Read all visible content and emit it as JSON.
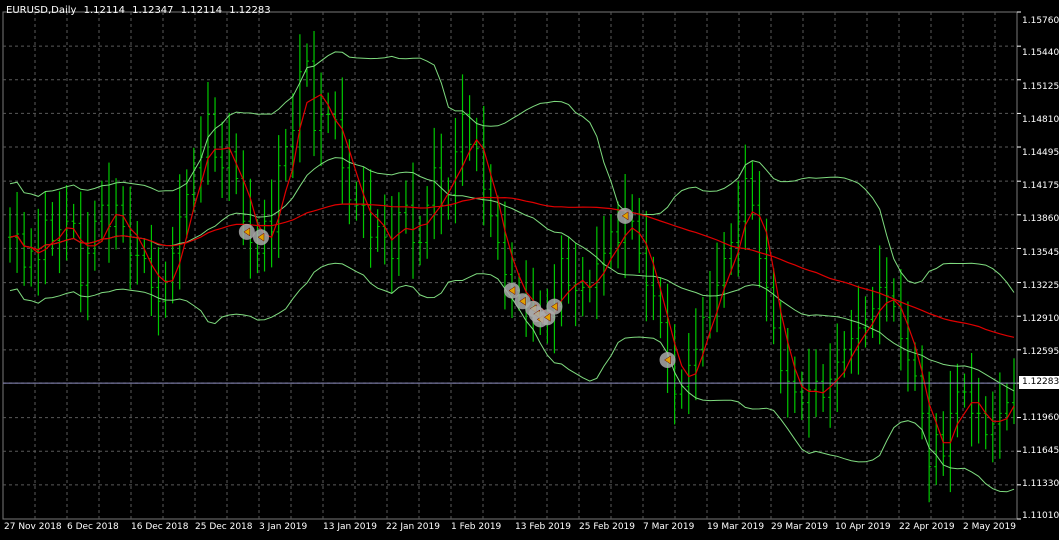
{
  "header": {
    "symbol": "EURUSD,Daily",
    "open": "1.12114",
    "high": "1.12347",
    "low": "1.12114",
    "close": "1.12283"
  },
  "price_axis": {
    "ticks": [
      "1.15760",
      "1.15440",
      "1.15125",
      "1.14810",
      "1.14495",
      "1.14175",
      "1.13860",
      "1.13545",
      "1.13225",
      "1.12910",
      "1.12595",
      "1.12283",
      "1.11960",
      "1.11645",
      "1.11330",
      "1.11010"
    ],
    "current_price": "1.12283"
  },
  "time_axis": {
    "labels": [
      "27 Nov 2018",
      "6 Dec 2018",
      "16 Dec 2018",
      "25 Dec 2018",
      "3 Jan 2019",
      "13 Jan 2019",
      "22 Jan 2019",
      "1 Feb 2019",
      "13 Feb 2019",
      "25 Feb 2019",
      "7 Mar 2019",
      "19 Mar 2019",
      "29 Mar 2019",
      "10 Apr 2019",
      "22 Apr 2019",
      "2 May 2019"
    ]
  },
  "colors": {
    "background": "#000000",
    "grid": "#5a5a5a",
    "bars": "#00c800",
    "bands": "#7fdb7f",
    "moving_average": "#e00000",
    "signal_marker": "#aaaaaa",
    "current_price_line": "#8c8cbe"
  },
  "chart_data": {
    "type": "line",
    "price_range": [
      1.1101,
      1.1576
    ],
    "close": [
      1.1365,
      1.1368,
      1.1337,
      1.1352,
      1.1344,
      1.1381,
      1.1362,
      1.1372,
      1.138,
      1.1378,
      1.132,
      1.135,
      1.138,
      1.1395,
      1.1375,
      1.1395,
      1.1375,
      1.1348,
      1.1348,
      1.1345,
      1.1318,
      1.1305,
      1.1324,
      1.135,
      1.1384,
      1.1405,
      1.143,
      1.144,
      1.148,
      1.144,
      1.143,
      1.1445,
      1.142,
      1.138,
      1.136,
      1.135,
      1.138,
      1.137,
      1.1432,
      1.145,
      1.1465,
      1.152,
      1.153,
      1.1465,
      1.148,
      1.148,
      1.1475,
      1.143,
      1.14,
      1.1395,
      1.1395,
      1.1365,
      1.1375,
      1.1365,
      1.1345,
      1.1388,
      1.1395,
      1.136,
      1.136,
      1.1395,
      1.143,
      1.1395,
      1.1405,
      1.1445,
      1.148,
      1.1452,
      1.1448,
      1.141,
      1.1385,
      1.136,
      1.133,
      1.1315,
      1.131,
      1.13,
      1.1298,
      1.1288,
      1.129,
      1.13,
      1.1345,
      1.132,
      1.1315,
      1.1318,
      1.1318,
      1.134,
      1.135,
      1.137,
      1.136,
      1.1385,
      1.138,
      1.135,
      1.132,
      1.131,
      1.1285,
      1.125,
      1.1218,
      1.1225,
      1.1245,
      1.126,
      1.129,
      1.131,
      1.132,
      1.1345,
      1.136,
      1.138,
      1.142,
      1.1395,
      1.1345,
      1.1318,
      1.128,
      1.124,
      1.123,
      1.122,
      1.121,
      1.1222,
      1.123,
      1.1215,
      1.1232,
      1.1248,
      1.126,
      1.127,
      1.128,
      1.1288,
      1.1298,
      1.1318,
      1.131,
      1.13,
      1.127,
      1.125,
      1.1235,
      1.12,
      1.115,
      1.118,
      1.116,
      1.12,
      1.122,
      1.122,
      1.12,
      1.12,
      1.118,
      1.119,
      1.12,
      1.121,
      1.1228
    ]
  }
}
